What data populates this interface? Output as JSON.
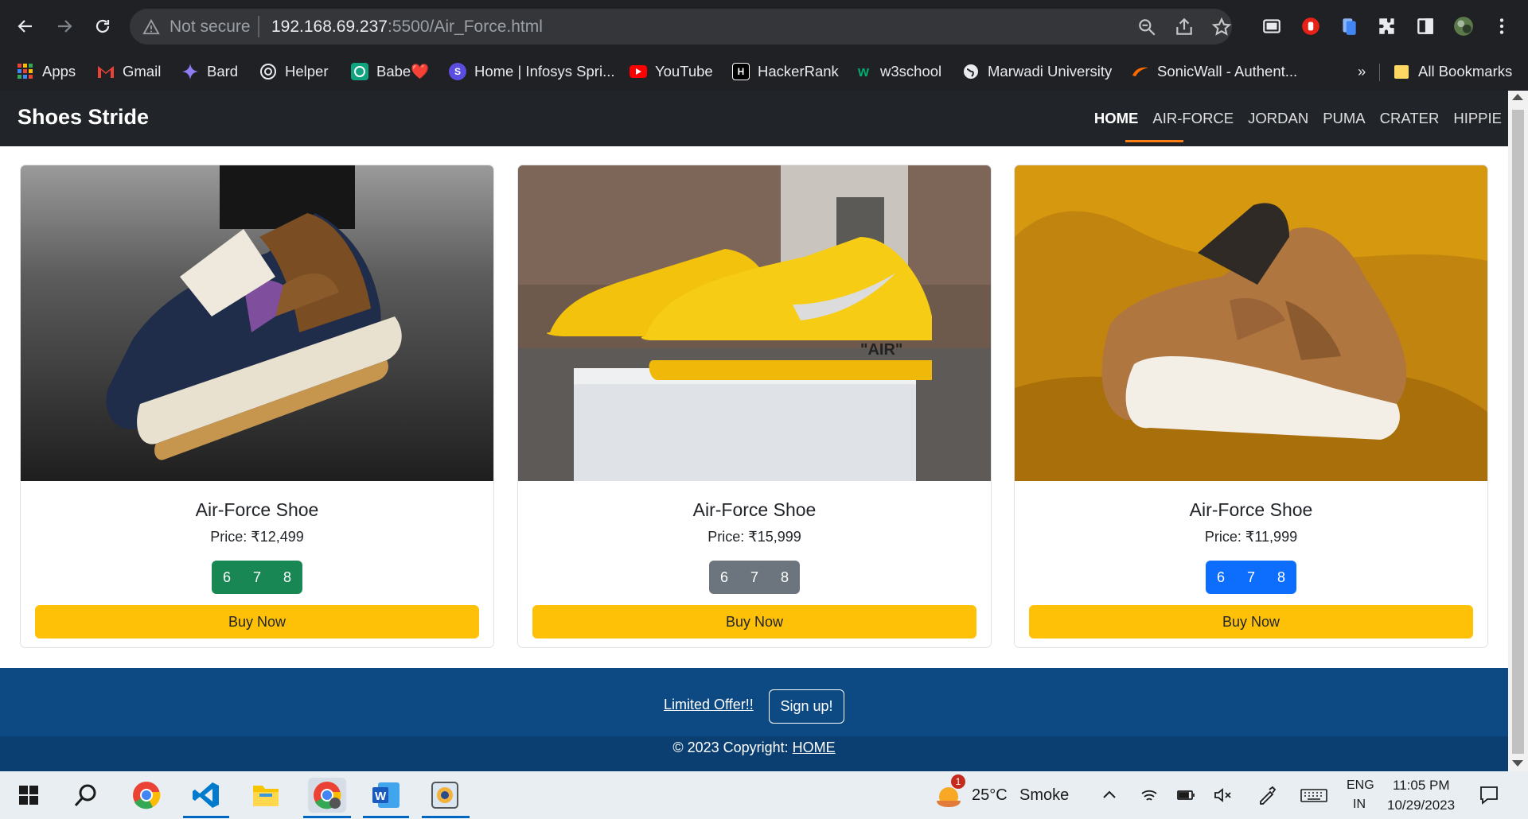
{
  "browser": {
    "security_label": "Not secure",
    "url_host": "192.168.69.237",
    "url_path": ":5500/Air_Force.html"
  },
  "bookmarks": {
    "items": [
      {
        "label": "Apps",
        "icon": "apps-grid-icon",
        "color": "#ea4335"
      },
      {
        "label": "Gmail",
        "icon": "gmail-icon",
        "color": "#ea4335"
      },
      {
        "label": "Bard",
        "icon": "bard-icon",
        "color": "#8ab4f8"
      },
      {
        "label": "Helper",
        "icon": "chatgpt-icon",
        "color": "#e8eaed"
      },
      {
        "label": "Babe❤️",
        "icon": "chatgpt-icon",
        "color": "#10a37f"
      },
      {
        "label": "Home | Infosys Spri...",
        "icon": "infosys-icon",
        "color": "#6b5cff"
      },
      {
        "label": "YouTube",
        "icon": "youtube-icon",
        "color": "#ff0000"
      },
      {
        "label": "HackerRank",
        "icon": "hackerrank-icon",
        "color": "#1ba94c"
      },
      {
        "label": "w3school",
        "icon": "w3school-icon",
        "color": "#04aa6d"
      },
      {
        "label": "Marwadi University",
        "icon": "globe-icon",
        "color": "#e8eaed"
      },
      {
        "label": "SonicWall - Authent...",
        "icon": "sonicwall-icon",
        "color": "#ff6a00"
      }
    ],
    "overflow": "»",
    "all_bookmarks": "All Bookmarks"
  },
  "site": {
    "brand": "Shoes Stride",
    "nav": [
      "HOME",
      "AIR-FORCE",
      "JORDAN",
      "PUMA",
      "CRATER",
      "HIPPIE"
    ],
    "active_nav": "HOME",
    "accent": "#fd7e14"
  },
  "products": [
    {
      "title": "Air-Force Shoe",
      "price": "Price: ₹12,499",
      "sizes": [
        "6",
        "7",
        "8"
      ],
      "size_color": "#198754",
      "buy": "Buy Now"
    },
    {
      "title": "Air-Force Shoe",
      "price": "Price: ₹15,999",
      "sizes": [
        "6",
        "7",
        "8"
      ],
      "size_color": "#6c757d",
      "buy": "Buy Now"
    },
    {
      "title": "Air-Force Shoe",
      "price": "Price: ₹11,999",
      "sizes": [
        "6",
        "7",
        "8"
      ],
      "size_color": "#0d6efd",
      "buy": "Buy Now"
    }
  ],
  "footer": {
    "offer": "Limited Offer!!",
    "signup": "Sign up!",
    "copyright": "© 2023 Copyright: ",
    "copyright_link": "HOME"
  },
  "taskbar": {
    "notification_count": "1",
    "weather_temp": "25°C",
    "weather_desc": "Smoke",
    "lang_top": "ENG",
    "lang_bottom": "IN",
    "time": "11:05 PM",
    "date": "10/29/2023"
  }
}
